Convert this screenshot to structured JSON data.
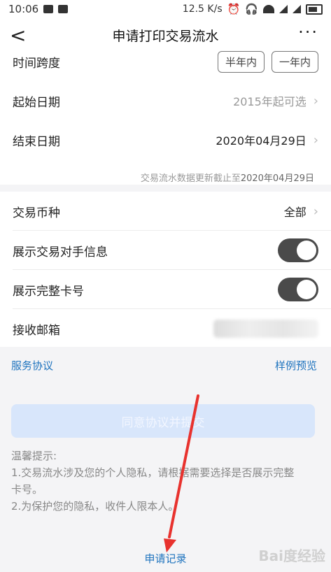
{
  "status_bar": {
    "time": "10:06",
    "speed": "12.5 K/s"
  },
  "nav": {
    "back_glyph": "<",
    "title": "申请打印交易流水",
    "more_glyph": "···"
  },
  "time_span": {
    "label": "时间跨度",
    "options": [
      "半年内",
      "一年内"
    ]
  },
  "start_date": {
    "label": "起始日期",
    "value": "2015年起可选"
  },
  "end_date": {
    "label": "结束日期",
    "value": "2020年04月29日"
  },
  "data_note": {
    "prefix": "交易流水数据更新截止至",
    "date": "2020年04月29日"
  },
  "currency": {
    "label": "交易币种",
    "value": "全部"
  },
  "show_counterparty": {
    "label": "展示交易对手信息",
    "on": true
  },
  "show_full_card": {
    "label": "展示完整卡号",
    "on": true
  },
  "email": {
    "label": "接收邮箱"
  },
  "links": {
    "service_agreement": "服务协议",
    "sample_preview": "样例预览"
  },
  "submit": {
    "label": "同意协议并提交"
  },
  "tips": {
    "title": "温馨提示:",
    "line1": "1.交易流水涉及您的个人隐私，请根据需要选择是否展示完整",
    "line1b": "卡号。",
    "line2": "2.为保护您的隐私，收件人限本人。"
  },
  "record": {
    "label": "申请记录"
  },
  "watermark": {
    "text": "Bai度经验"
  },
  "colors": {
    "accent": "#1e73be",
    "toggle_on": "#4a4a4a",
    "submit_disabled": "#d8e6fb",
    "arrow": "#e8322e"
  }
}
